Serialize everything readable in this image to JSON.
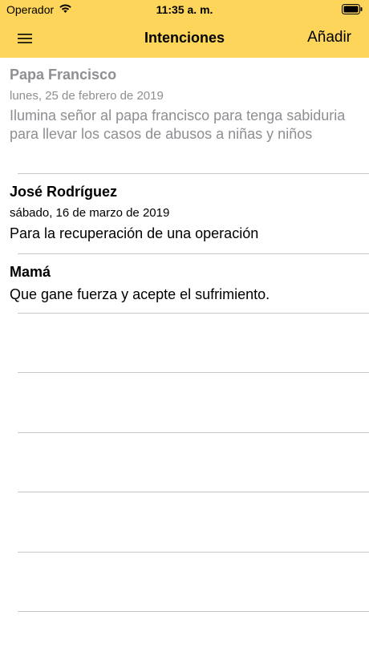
{
  "status": {
    "carrier": "Operador",
    "time": "11:35 a. m."
  },
  "nav": {
    "title": "Intenciones",
    "add_label": "Añadir",
    "menu_icon": "hamburger-menu-icon"
  },
  "intentions": [
    {
      "name": "Papa Francisco",
      "date": "lunes, 25 de febrero de 2019",
      "text": "Ilumina señor al papa francisco para tenga sabiduria para llevar los casos de abusos a niñas y niños",
      "past": true
    },
    {
      "name": "José Rodríguez",
      "date": "sábado, 16 de marzo de 2019",
      "text": "Para la recuperación de una operación",
      "past": false
    },
    {
      "name": "Mamá",
      "date": "",
      "text": "Que gane fuerza y acepte el sufrimiento.",
      "past": false
    }
  ],
  "colors": {
    "accent": "#fdd55b",
    "separator": "#c8c7cc",
    "past_text": "#8e8e93"
  }
}
